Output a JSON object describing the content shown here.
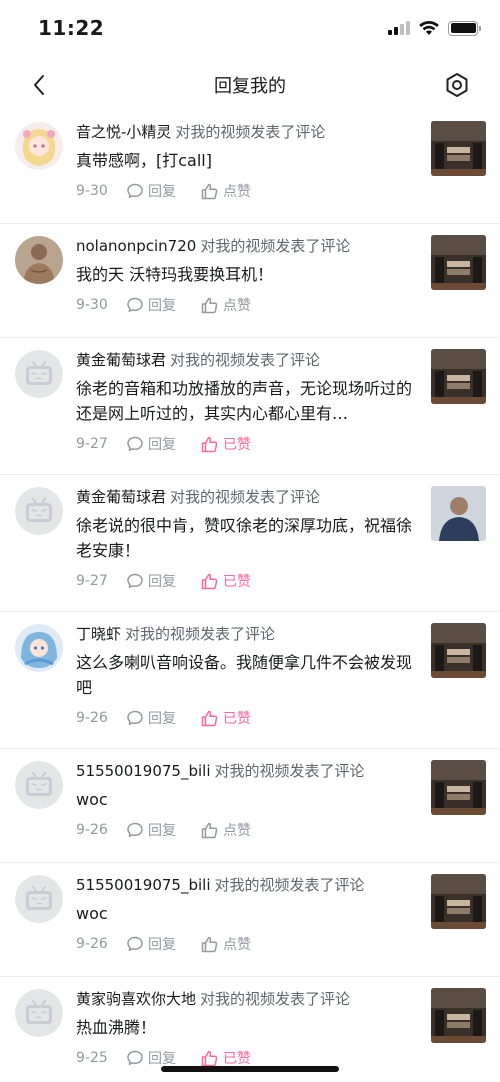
{
  "status_bar": {
    "time": "11:22"
  },
  "nav": {
    "title": "回复我的"
  },
  "replies": [
    {
      "username": "音之悦-小精灵",
      "action": "对我的视频发表了评论",
      "comment": "真带感啊，[打call]",
      "date": "9-30",
      "reply_label": "回复",
      "like_label": "点赞",
      "liked": false,
      "avatar": "anime-girl-avatar",
      "thumb": "video-thumbnail"
    },
    {
      "username": "nolanonpcin720",
      "action": "对我的视频发表了评论",
      "comment": "我的天 沃特玛我要换耳机！",
      "date": "9-30",
      "reply_label": "回复",
      "like_label": "点赞",
      "liked": false,
      "avatar": "muscle-man-avatar",
      "thumb": "video-thumbnail"
    },
    {
      "username": "黄金葡萄球君",
      "action": "对我的视频发表了评论",
      "comment": "徐老的音箱和功放播放的声音，无论现场听过的还是网上听过的，其实内心都心里有…",
      "date": "9-27",
      "reply_label": "回复",
      "like_label": "已赞",
      "liked": true,
      "avatar": "default-tv-avatar",
      "thumb": "video-thumbnail"
    },
    {
      "username": "黄金葡萄球君",
      "action": "对我的视频发表了评论",
      "comment": "徐老说的很中肯，赞叹徐老的深厚功底，祝福徐老安康！",
      "date": "9-27",
      "reply_label": "回复",
      "like_label": "已赞",
      "liked": true,
      "avatar": "default-tv-avatar",
      "thumb": "video-thumbnail-person"
    },
    {
      "username": "丁晓虾",
      "action": "对我的视频发表了评论",
      "comment": "这么多喇叭音响设备。我随便拿几件不会被发现吧",
      "date": "9-26",
      "reply_label": "回复",
      "like_label": "已赞",
      "liked": true,
      "avatar": "anime-girl-avatar-blue",
      "thumb": "video-thumbnail"
    },
    {
      "username": "51550019075_bili",
      "action": "对我的视频发表了评论",
      "comment": "woc",
      "date": "9-26",
      "reply_label": "回复",
      "like_label": "点赞",
      "liked": false,
      "avatar": "default-tv-avatar",
      "thumb": "video-thumbnail"
    },
    {
      "username": "51550019075_bili",
      "action": "对我的视频发表了评论",
      "comment": "woc",
      "date": "9-26",
      "reply_label": "回复",
      "like_label": "点赞",
      "liked": false,
      "avatar": "default-tv-avatar",
      "thumb": "video-thumbnail"
    },
    {
      "username": "黄家驹喜欢你大地",
      "action": "对我的视频发表了评论",
      "comment": "热血沸腾！",
      "date": "9-25",
      "reply_label": "回复",
      "like_label": "已赞",
      "liked": true,
      "avatar": "default-tv-avatar",
      "thumb": "video-thumbnail"
    }
  ],
  "colors": {
    "liked": "#ff6699",
    "muted": "#9499a0",
    "text": "#18191c"
  }
}
